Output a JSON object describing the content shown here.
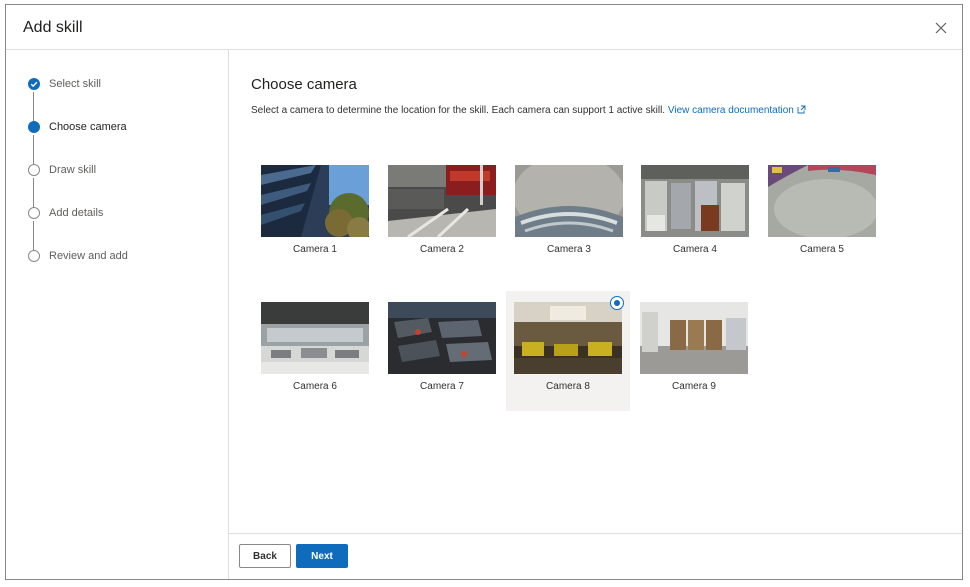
{
  "dialog": {
    "title": "Add skill"
  },
  "steps": [
    {
      "label": "Select skill",
      "state": "done"
    },
    {
      "label": "Choose camera",
      "state": "current"
    },
    {
      "label": "Draw skill",
      "state": "todo"
    },
    {
      "label": "Add details",
      "state": "todo"
    },
    {
      "label": "Review and add",
      "state": "todo"
    }
  ],
  "main": {
    "title": "Choose camera",
    "description": "Select a camera to determine the location for the skill. Each camera can support 1 active skill.",
    "doc_link": "View camera documentation"
  },
  "cameras": [
    {
      "label": "Camera 1",
      "selected": false
    },
    {
      "label": "Camera 2",
      "selected": false
    },
    {
      "label": "Camera 3",
      "selected": false
    },
    {
      "label": "Camera 4",
      "selected": false
    },
    {
      "label": "Camera 5",
      "selected": false
    },
    {
      "label": "Camera 6",
      "selected": false
    },
    {
      "label": "Camera 7",
      "selected": false
    },
    {
      "label": "Camera 8",
      "selected": true
    },
    {
      "label": "Camera 9",
      "selected": false
    }
  ],
  "footer": {
    "back_label": "Back",
    "next_label": "Next"
  },
  "colors": {
    "accent": "#0f6cbd",
    "border": "#e1dfdd",
    "selected_bg": "#f3f2f1"
  },
  "icons": [
    "close-icon",
    "check-icon",
    "external-link-icon",
    "radio-selected-icon"
  ]
}
